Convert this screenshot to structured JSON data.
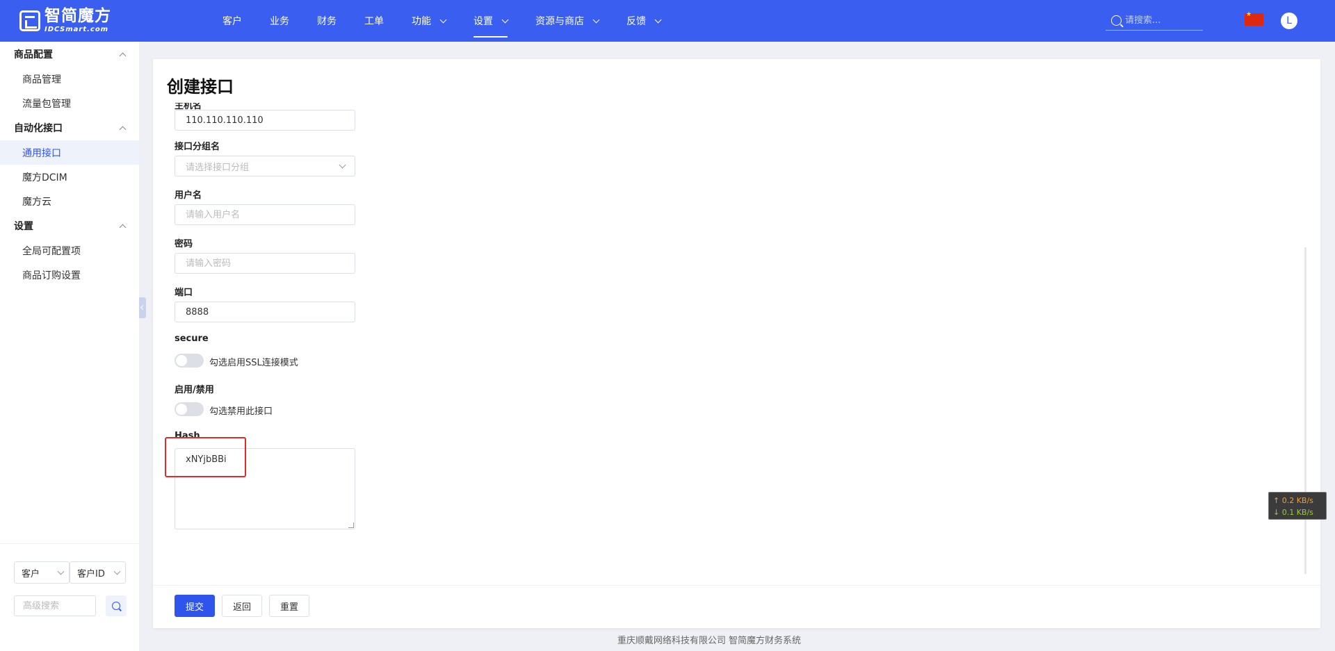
{
  "logo": {
    "cn": "智简魔方",
    "en": "IDCSmart.com"
  },
  "nav": [
    {
      "label": "客户",
      "has_dropdown": false,
      "active": false
    },
    {
      "label": "业务",
      "has_dropdown": false,
      "active": false
    },
    {
      "label": "财务",
      "has_dropdown": false,
      "active": false
    },
    {
      "label": "工单",
      "has_dropdown": false,
      "active": false
    },
    {
      "label": "功能",
      "has_dropdown": true,
      "active": false
    },
    {
      "label": "设置",
      "has_dropdown": true,
      "active": true
    },
    {
      "label": "资源与商店",
      "has_dropdown": true,
      "active": false
    },
    {
      "label": "反馈",
      "has_dropdown": true,
      "active": false
    }
  ],
  "header": {
    "search_placeholder": "请搜索...",
    "avatar_letter": "L"
  },
  "sidebar": {
    "groups": [
      {
        "title": "商品配置",
        "items": [
          "商品管理",
          "流量包管理"
        ]
      },
      {
        "title": "自动化接口",
        "items": [
          "通用接口",
          "魔方DCIM",
          "魔方云"
        ]
      },
      {
        "title": "设置",
        "items": [
          "全局可配置项",
          "商品订购设置"
        ]
      }
    ],
    "active_item": "通用接口",
    "filter_type": "客户",
    "filter_field": "客户ID",
    "advanced_search_placeholder": "高级搜索"
  },
  "page": {
    "title": "创建接口",
    "partial_label": "主机名",
    "host_value": "110.110.110.110",
    "group_label": "接口分组名",
    "group_placeholder": "请选择接口分组",
    "username_label": "用户名",
    "username_placeholder": "请输入用户名",
    "password_label": "密码",
    "password_placeholder": "请输入密码",
    "port_label": "端口",
    "port_value": "8888",
    "secure_label": "secure",
    "secure_text": "勾选启用SSL连接模式",
    "secure_on": false,
    "enable_label": "启用/禁用",
    "enable_text": "勾选禁用此接口",
    "enable_on": false,
    "hash_label": "Hash",
    "hash_value": "xNYjbBBi"
  },
  "buttons": {
    "submit": "提交",
    "back": "返回",
    "reset": "重置"
  },
  "network": {
    "up": "↑ 0.2 KB/s",
    "down": "↓ 0.1 KB/s"
  },
  "footer": {
    "copyright": "重庆顺戴网络科技有限公司 智简魔方财务系统"
  },
  "colors": {
    "brand": "#3a5ef0",
    "primary": "#2f54eb",
    "highlight": "#e12b2b"
  }
}
